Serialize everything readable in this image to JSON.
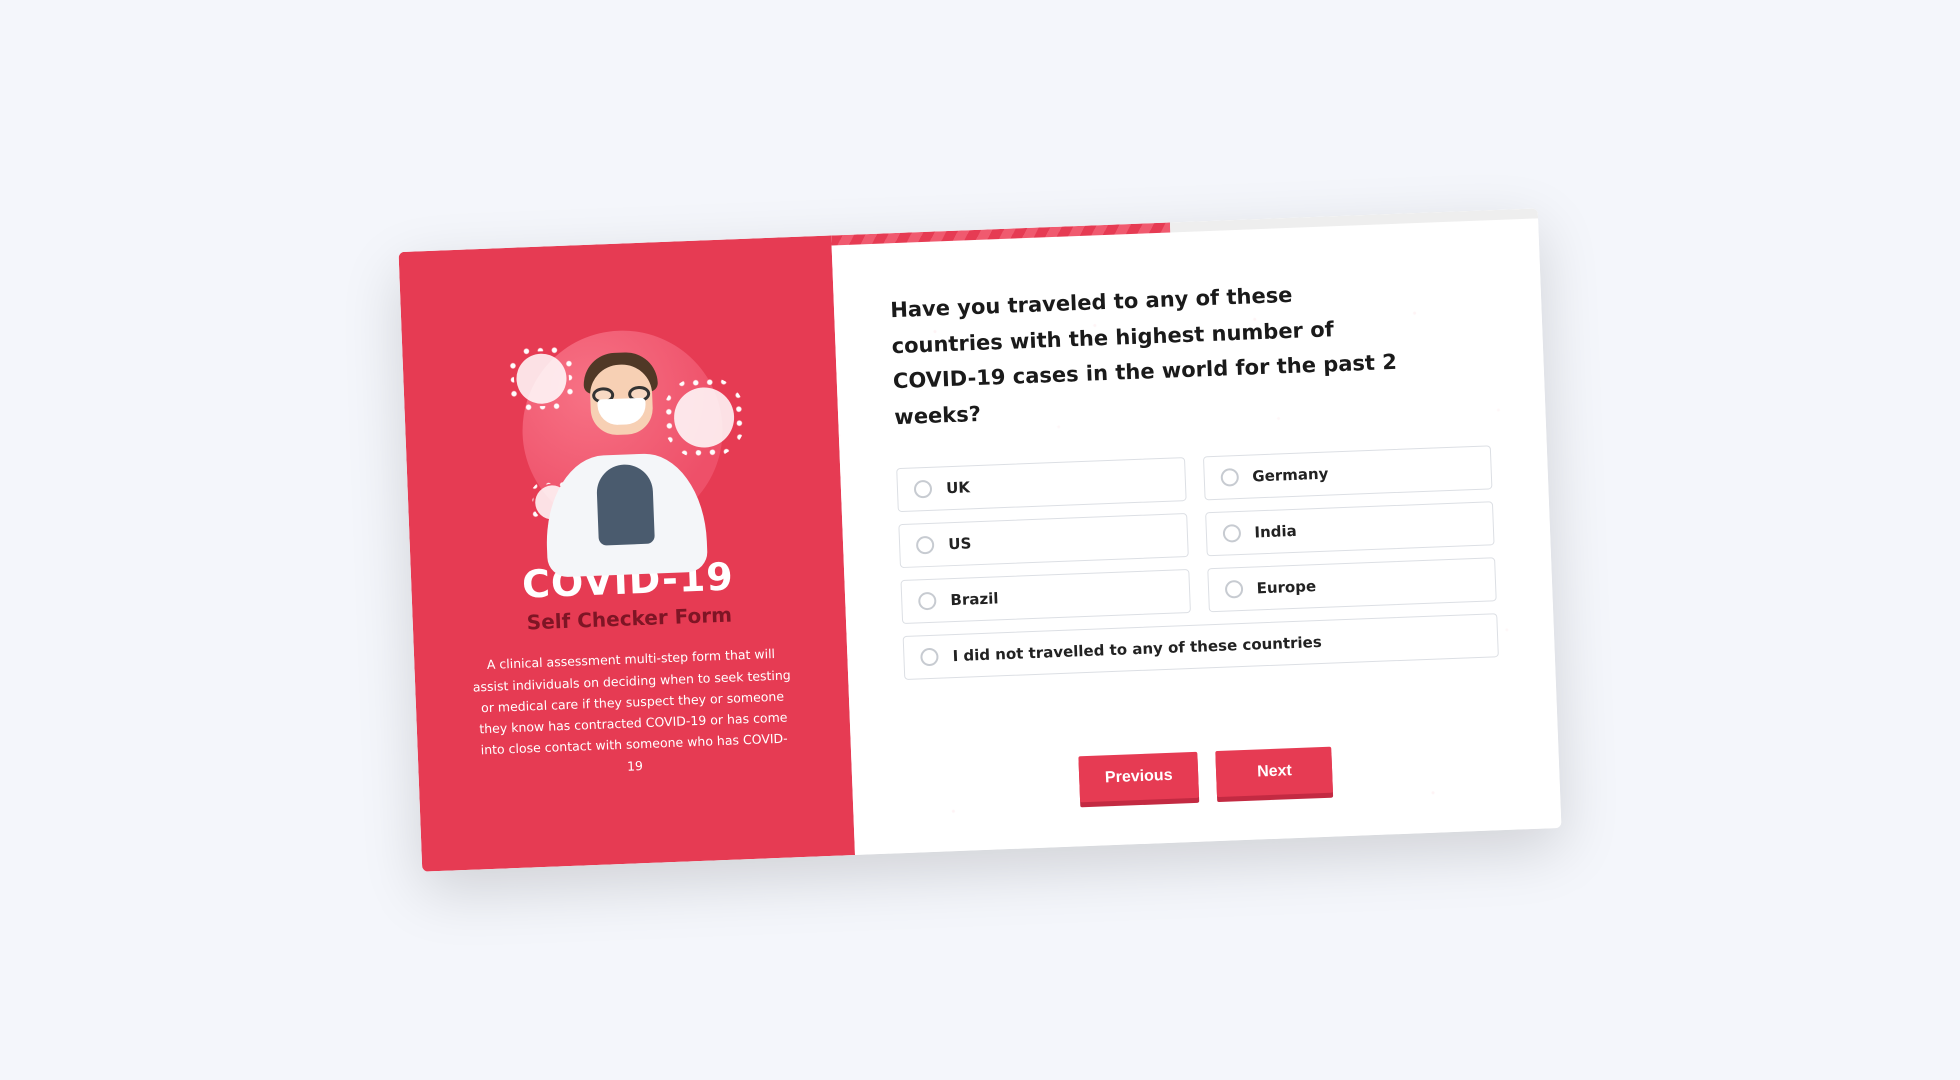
{
  "colors": {
    "accent": "#e63b53",
    "accent_dark": "#c32a42"
  },
  "progress": {
    "percent": 48
  },
  "sidebar": {
    "title": "COVID-19",
    "subtitle": "Self Checker Form",
    "description": "A clinical assessment multi-step form that will assist individuals on deciding when to seek testing or medical care if they suspect they or someone they know has contracted COVID-19 or has come into close contact with someone who has COVID-19"
  },
  "form": {
    "question": "Have you traveled to any of these countries with the highest number of COVID-19 cases in the world for the past 2 weeks?",
    "options": [
      {
        "label": "UK"
      },
      {
        "label": "Germany"
      },
      {
        "label": "US"
      },
      {
        "label": "India"
      },
      {
        "label": "Brazil"
      },
      {
        "label": "Europe"
      },
      {
        "label": "I did not travelled to any of these countries",
        "full": true
      }
    ],
    "previous_label": "Previous",
    "next_label": "Next"
  }
}
